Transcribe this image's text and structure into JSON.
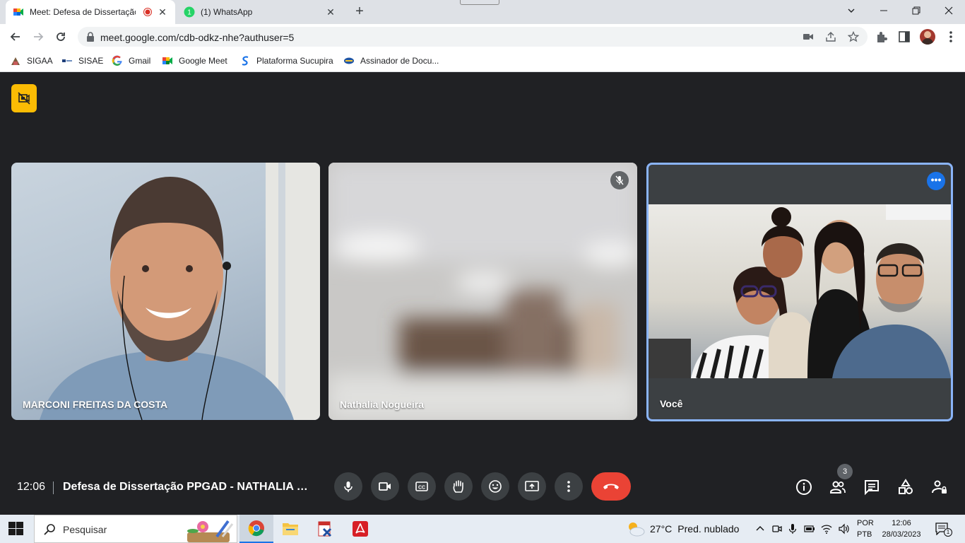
{
  "browser": {
    "tabs": [
      {
        "title": "Meet: Defesa de Dissertação",
        "active": true,
        "recording": true
      },
      {
        "title": "(1) WhatsApp",
        "active": false
      }
    ],
    "url": "meet.google.com/cdb-odkz-nhe?authuser=5",
    "bookmarks": [
      {
        "label": "SIGAA"
      },
      {
        "label": "SISAE"
      },
      {
        "label": "Gmail"
      },
      {
        "label": "Google Meet"
      },
      {
        "label": "Plataforma Sucupira"
      },
      {
        "label": "Assinador de Docu..."
      }
    ],
    "whatsapp_badge": "1"
  },
  "meet": {
    "participants": [
      {
        "name": "MARCONI FREITAS DA COSTA",
        "muted": false
      },
      {
        "name": "Nathalia Nogueira",
        "muted": true
      },
      {
        "name": "Você",
        "muted": false,
        "active_speaker": true
      }
    ],
    "clock": "12:06",
    "meeting_title": "Defesa de Dissertação PPGAD - NATHALIA NOGUEIRA",
    "people_count": "3",
    "colors": {
      "accent": "#8ab4f8",
      "end_call": "#ea4335",
      "recording": "#fbbc04"
    }
  },
  "taskbar": {
    "search_placeholder": "Pesquisar",
    "weather_temp": "27°C",
    "weather_desc": "Pred. nublado",
    "lang_line1": "POR",
    "lang_line2": "PTB",
    "time": "12:06",
    "date": "28/03/2023",
    "notification_count": "1"
  }
}
